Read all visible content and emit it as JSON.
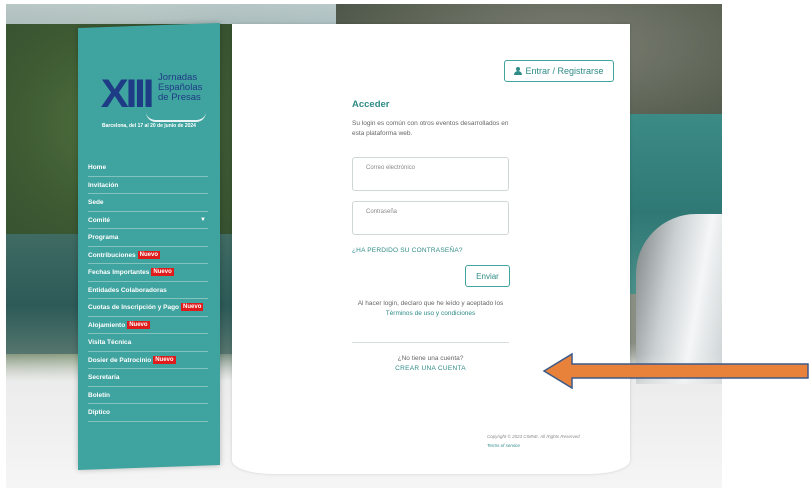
{
  "sidebar": {
    "logo": {
      "roman": "XIII",
      "line1": "Jornadas",
      "line2": "Españolas",
      "line3": "de Presas"
    },
    "dates": "Barcelona, del 17 al 20 de junio de 2024",
    "new_badge": "Nuevo",
    "items": [
      {
        "label": "Home",
        "badge": false
      },
      {
        "label": "Invitación",
        "badge": false
      },
      {
        "label": "Sede",
        "badge": false
      },
      {
        "label": "Comité",
        "badge": false,
        "caret": true
      },
      {
        "label": "Programa",
        "badge": false
      },
      {
        "label": "Contribuciones",
        "badge": true
      },
      {
        "label": "Fechas Importantes",
        "badge": true
      },
      {
        "label": "Entidades Colaboradoras",
        "badge": false
      },
      {
        "label": "Cuotas de Inscripción y Pago",
        "badge": true
      },
      {
        "label": "Alojamiento",
        "badge": true
      },
      {
        "label": "Visita Técnica",
        "badge": false
      },
      {
        "label": "Dosier de Patrocinio",
        "badge": true
      },
      {
        "label": "Secretaría",
        "badge": false
      },
      {
        "label": "Boletín",
        "badge": false
      },
      {
        "label": "Díptico",
        "badge": false
      }
    ]
  },
  "login": {
    "entrar_button": "Entrar / Registrarse",
    "title": "Acceder",
    "description": "Su login es común con otros eventos desarrollados en esta plataforma web.",
    "email_placeholder": "Correo electrónico",
    "password_placeholder": "Contraseña",
    "forgot": "¿HA PERDIDO SU CONTRASEÑA?",
    "send_button": "Enviar",
    "terms_text": "Al hacer login, declaro que he leído y aceptado los",
    "terms_link": "Términos de uso y condiciones",
    "no_account": "¿No tiene una cuenta?",
    "create_account": "CREAR UNA CUENTA"
  },
  "footer": {
    "copyright": "Copyright © 2023 CIMNE. All Rights Reserved",
    "terms_of_service": "Terms of service"
  },
  "colors": {
    "accent": "#3fa39f",
    "accent_text": "#2e8b87",
    "badge": "#e01b1b",
    "arrow": "#e8823a",
    "logo_blue": "#1e3b86"
  }
}
